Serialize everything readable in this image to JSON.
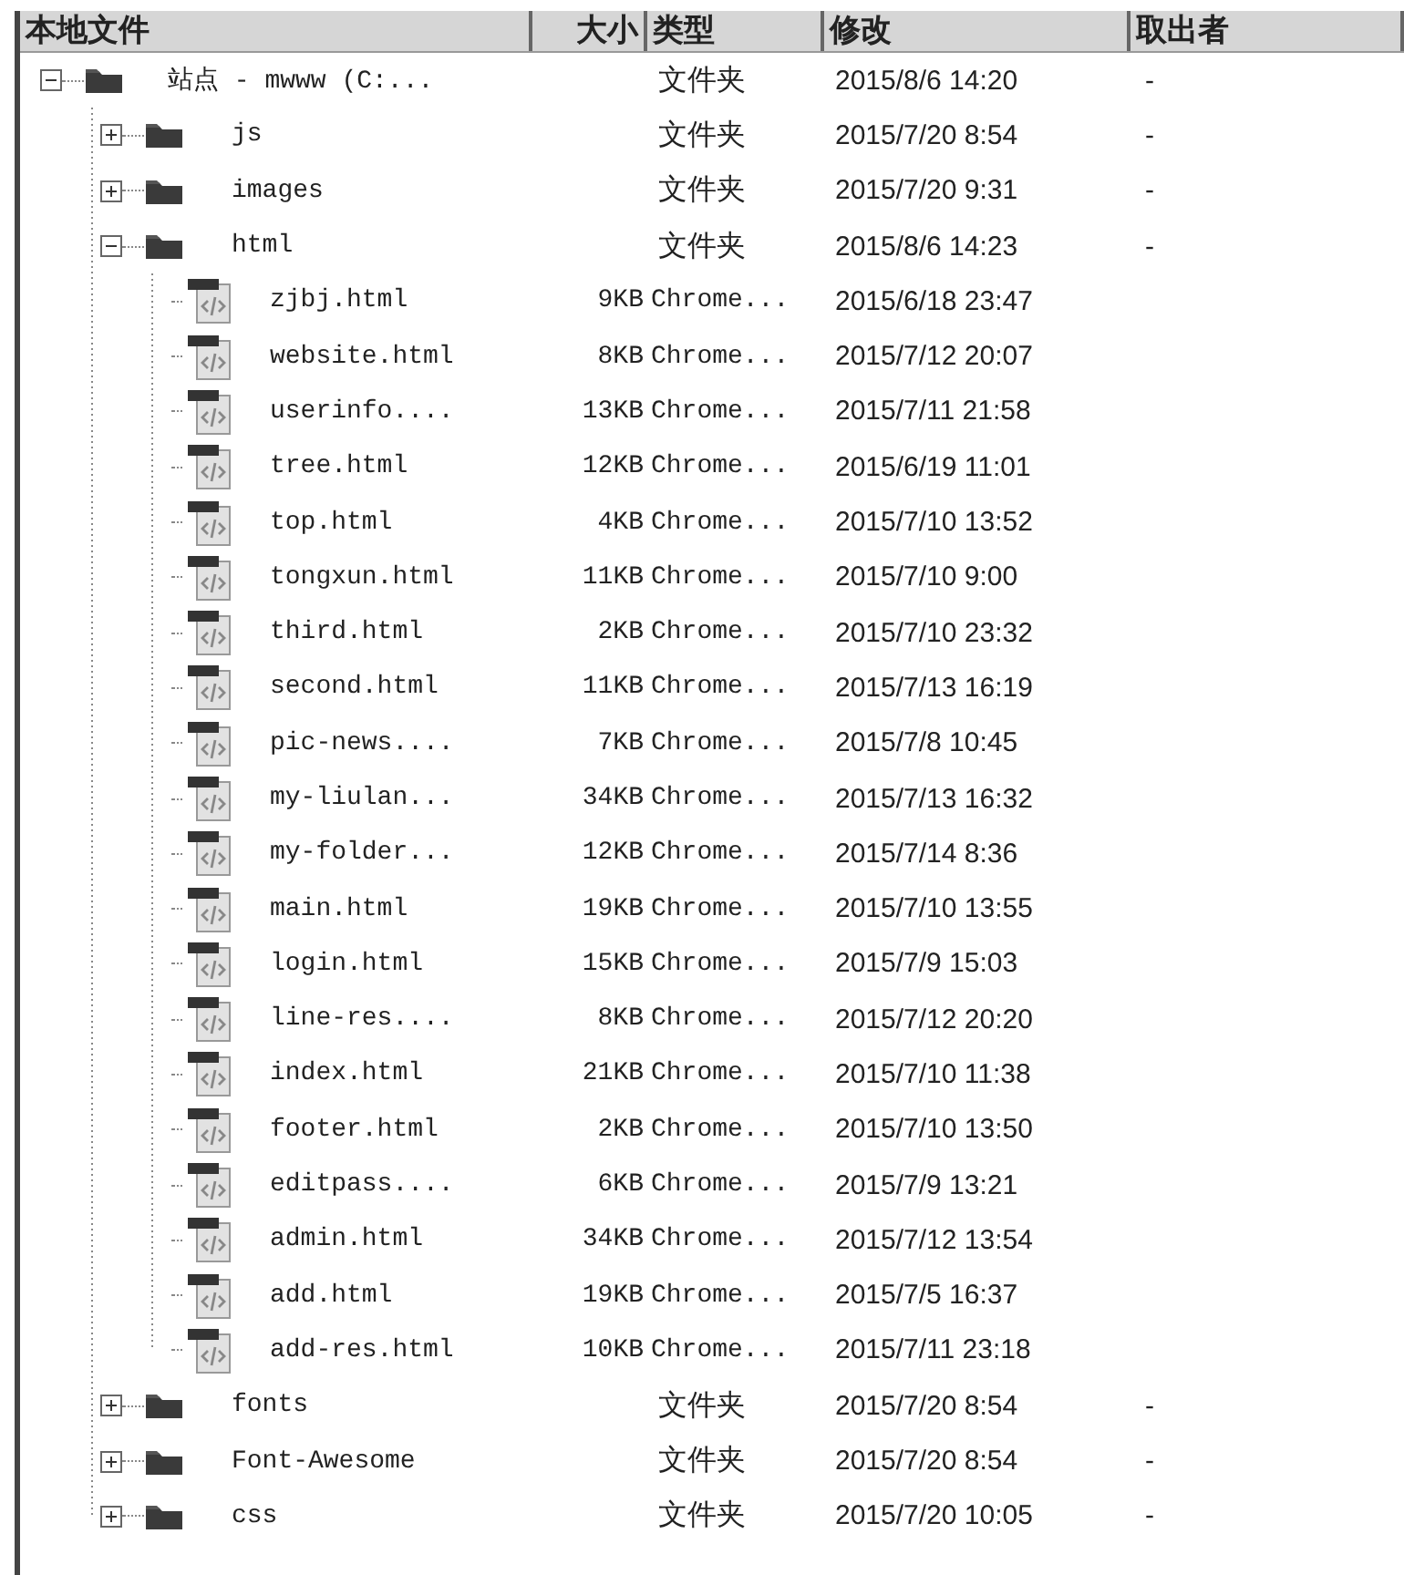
{
  "columns": [
    {
      "label": "本地文件"
    },
    {
      "label": "大小"
    },
    {
      "label": "类型"
    },
    {
      "label": "修改"
    },
    {
      "label": "取出者"
    }
  ],
  "tree": [
    {
      "kind": "folder",
      "name": "站点 - mwww (C:...",
      "type": "文件夹",
      "modified": "2015/8/6 14:20",
      "checked_out": "-",
      "expanded": true,
      "children": [
        {
          "kind": "folder",
          "name": "js",
          "type": "文件夹",
          "modified": "2015/7/20 8:54",
          "checked_out": "-",
          "expanded": false
        },
        {
          "kind": "folder",
          "name": "images",
          "type": "文件夹",
          "modified": "2015/7/20 9:31",
          "checked_out": "-",
          "expanded": false
        },
        {
          "kind": "folder",
          "name": "html",
          "type": "文件夹",
          "modified": "2015/8/6 14:23",
          "checked_out": "-",
          "expanded": true,
          "children": [
            {
              "kind": "file",
              "name": "zjbj.html",
              "size": "9KB",
              "type": "Chrome...",
              "modified": "2015/6/18 23:47"
            },
            {
              "kind": "file",
              "name": "website.html",
              "size": "8KB",
              "type": "Chrome...",
              "modified": "2015/7/12 20:07"
            },
            {
              "kind": "file",
              "name": "userinfo....",
              "size": "13KB",
              "type": "Chrome...",
              "modified": "2015/7/11 21:58"
            },
            {
              "kind": "file",
              "name": "tree.html",
              "size": "12KB",
              "type": "Chrome...",
              "modified": "2015/6/19 11:01"
            },
            {
              "kind": "file",
              "name": "top.html",
              "size": "4KB",
              "type": "Chrome...",
              "modified": "2015/7/10 13:52"
            },
            {
              "kind": "file",
              "name": "tongxun.html",
              "size": "11KB",
              "type": "Chrome...",
              "modified": "2015/7/10 9:00"
            },
            {
              "kind": "file",
              "name": "third.html",
              "size": "2KB",
              "type": "Chrome...",
              "modified": "2015/7/10 23:32"
            },
            {
              "kind": "file",
              "name": "second.html",
              "size": "11KB",
              "type": "Chrome...",
              "modified": "2015/7/13 16:19"
            },
            {
              "kind": "file",
              "name": "pic-news....",
              "size": "7KB",
              "type": "Chrome...",
              "modified": "2015/7/8 10:45"
            },
            {
              "kind": "file",
              "name": "my-liulan...",
              "size": "34KB",
              "type": "Chrome...",
              "modified": "2015/7/13 16:32"
            },
            {
              "kind": "file",
              "name": "my-folder...",
              "size": "12KB",
              "type": "Chrome...",
              "modified": "2015/7/14 8:36"
            },
            {
              "kind": "file",
              "name": "main.html",
              "size": "19KB",
              "type": "Chrome...",
              "modified": "2015/7/10 13:55"
            },
            {
              "kind": "file",
              "name": "login.html",
              "size": "15KB",
              "type": "Chrome...",
              "modified": "2015/7/9 15:03"
            },
            {
              "kind": "file",
              "name": "line-res....",
              "size": "8KB",
              "type": "Chrome...",
              "modified": "2015/7/12 20:20"
            },
            {
              "kind": "file",
              "name": "index.html",
              "size": "21KB",
              "type": "Chrome...",
              "modified": "2015/7/10 11:38"
            },
            {
              "kind": "file",
              "name": "footer.html",
              "size": "2KB",
              "type": "Chrome...",
              "modified": "2015/7/10 13:50"
            },
            {
              "kind": "file",
              "name": "editpass....",
              "size": "6KB",
              "type": "Chrome...",
              "modified": "2015/7/9 13:21"
            },
            {
              "kind": "file",
              "name": "admin.html",
              "size": "34KB",
              "type": "Chrome...",
              "modified": "2015/7/12 13:54"
            },
            {
              "kind": "file",
              "name": "add.html",
              "size": "19KB",
              "type": "Chrome...",
              "modified": "2015/7/5 16:37"
            },
            {
              "kind": "file",
              "name": "add-res.html",
              "size": "10KB",
              "type": "Chrome...",
              "modified": "2015/7/11 23:18"
            }
          ]
        },
        {
          "kind": "folder",
          "name": "fonts",
          "type": "文件夹",
          "modified": "2015/7/20 8:54",
          "checked_out": "-",
          "expanded": false
        },
        {
          "kind": "folder",
          "name": "Font-Awesome",
          "type": "文件夹",
          "modified": "2015/7/20 8:54",
          "checked_out": "-",
          "expanded": false
        },
        {
          "kind": "folder",
          "name": "css",
          "type": "文件夹",
          "modified": "2015/7/20 10:05",
          "checked_out": "-",
          "expanded": false
        }
      ]
    }
  ]
}
